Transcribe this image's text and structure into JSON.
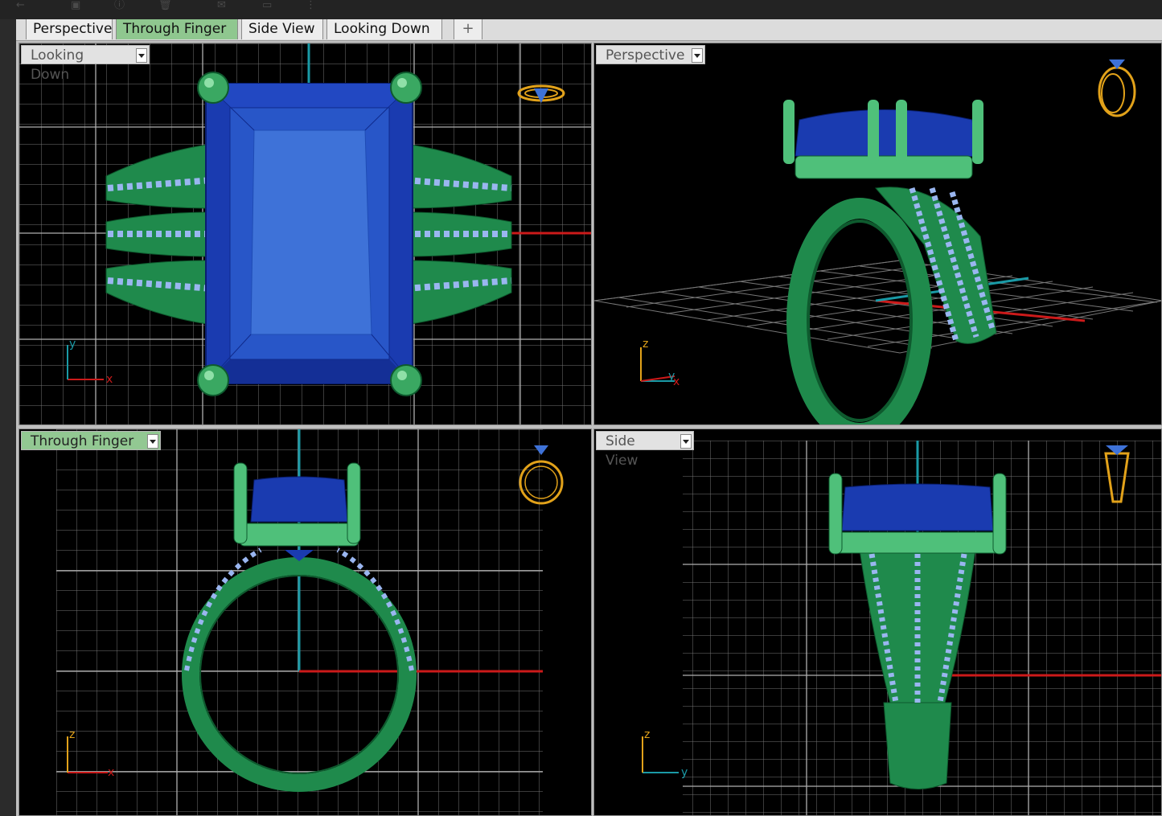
{
  "tabs": [
    {
      "label": "Perspective",
      "active": false
    },
    {
      "label": "Through Finger",
      "active": true
    },
    {
      "label": "Side View",
      "active": false
    },
    {
      "label": "Looking Down",
      "active": false
    }
  ],
  "add_tab_symbol": "+",
  "viewports": {
    "top_left": {
      "label": "Looking Down",
      "active": false,
      "axis_a": "x",
      "axis_b": "y"
    },
    "top_right": {
      "label": "Perspective",
      "active": false,
      "axis_a": "x",
      "axis_b": "z",
      "axis_c": "y"
    },
    "bottom_left": {
      "label": "Through Finger",
      "active": true,
      "axis_a": "x",
      "axis_b": "z"
    },
    "bottom_right": {
      "label": "Side View",
      "active": false,
      "axis_a": "y",
      "axis_b": "z"
    }
  },
  "colors": {
    "metal": "#1f8a4c",
    "metal_light": "#4fc07a",
    "gem": "#1a3bb0",
    "gem_light": "#3e72d8",
    "accent_stones": "#9ab6f0",
    "grid": "#7a7a7a",
    "x_axis": "#cc1a1a",
    "y_axis": "#1a9aa6",
    "widget": "#e2a21a"
  },
  "toolbar_icons": [
    "back-icon",
    "save-icon",
    "info-icon",
    "delete-icon",
    "mail-icon",
    "folder-icon",
    "more-icon"
  ]
}
